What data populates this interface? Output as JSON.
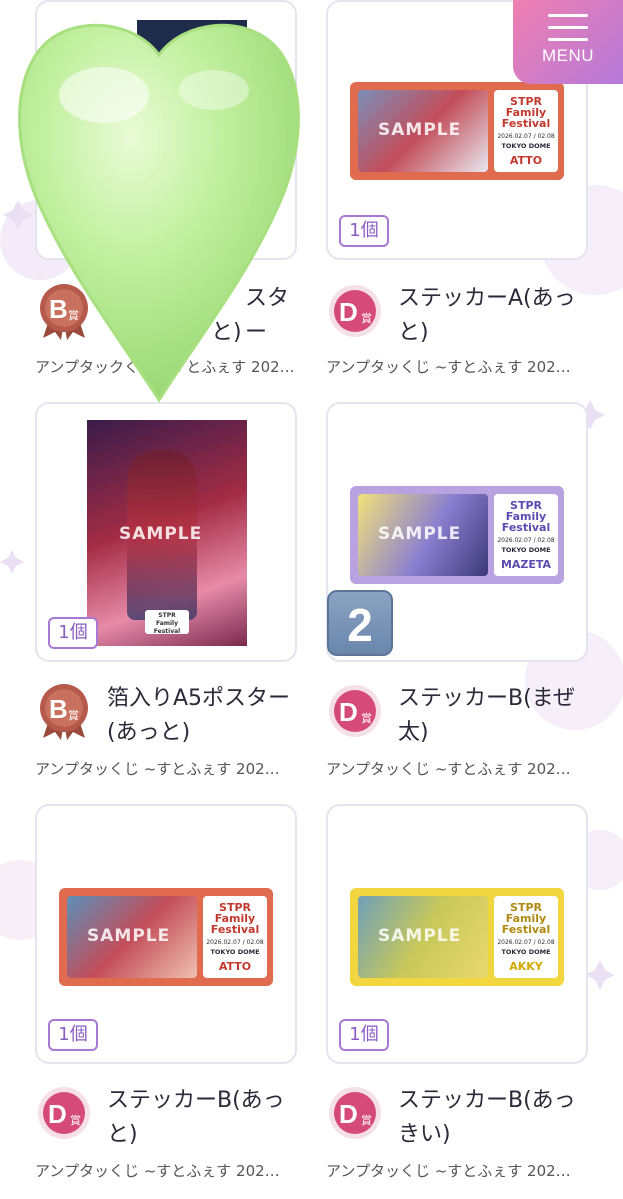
{
  "menu": {
    "label": "MENU"
  },
  "items": [
    {
      "id": "c1",
      "prize": "B賞",
      "name": "箔入りA5ポスター(あっと)",
      "name_visible": "スター",
      "name_line2": "と)",
      "subtitle": "アンプタックくじ ~すとふぇす 202…",
      "quantity": ""
    },
    {
      "id": "c2",
      "prize": "D賞",
      "name": "ステッカーA(あっと)",
      "subtitle": "アンプタッくじ ~すとふぇす 202…",
      "quantity": "1個",
      "stub": {
        "logo": "STPR Family Festival",
        "date": "2026.02.07 / 02.08",
        "venue": "TOKYO DOME",
        "member": "ATTO"
      }
    },
    {
      "id": "c3",
      "prize": "B賞",
      "name": "箔入りA5ポスター(あっと)",
      "subtitle": "アンプタッくじ ~すとふぇす 202…",
      "quantity": "1個"
    },
    {
      "id": "c4",
      "prize": "D賞",
      "name": "ステッカーB(まぜ太)",
      "subtitle": "アンプタッくじ ~すとふぇす 202…",
      "quantity": "",
      "stub": {
        "logo": "STPR Family Festival",
        "date": "2026.02.07 / 02.08",
        "venue": "TOKYO DOME",
        "member": "MAZETA"
      }
    },
    {
      "id": "c5",
      "prize": "D賞",
      "name": "ステッカーB(あっと)",
      "subtitle": "アンプタッくじ ~すとふぇす 202…",
      "quantity": "1個",
      "stub": {
        "logo": "STPR Family Festival",
        "date": "2026.02.07 / 02.08",
        "venue": "TOKYO DOME",
        "member": "ATTO"
      }
    },
    {
      "id": "c6",
      "prize": "D賞",
      "name": "ステッカーB(あっきい)",
      "subtitle": "アンプタッくじ ~すとふぇす 202…",
      "quantity": "1個",
      "stub": {
        "logo": "STPR Family Festival",
        "date": "2026.02.07 / 02.08",
        "venue": "TOKYO DOME",
        "member": "AKKY"
      }
    }
  ],
  "sample_text": "SAMPLE",
  "overlay": {
    "number_badge": "2",
    "heart_icon": "green-heart-icon"
  },
  "colors": {
    "accent": "#a779d4",
    "menu_gradient_start": "#ef7fb0",
    "menu_gradient_end": "#b57ad9",
    "prize_b": "#b5594a",
    "prize_d": "#d64a7a"
  }
}
